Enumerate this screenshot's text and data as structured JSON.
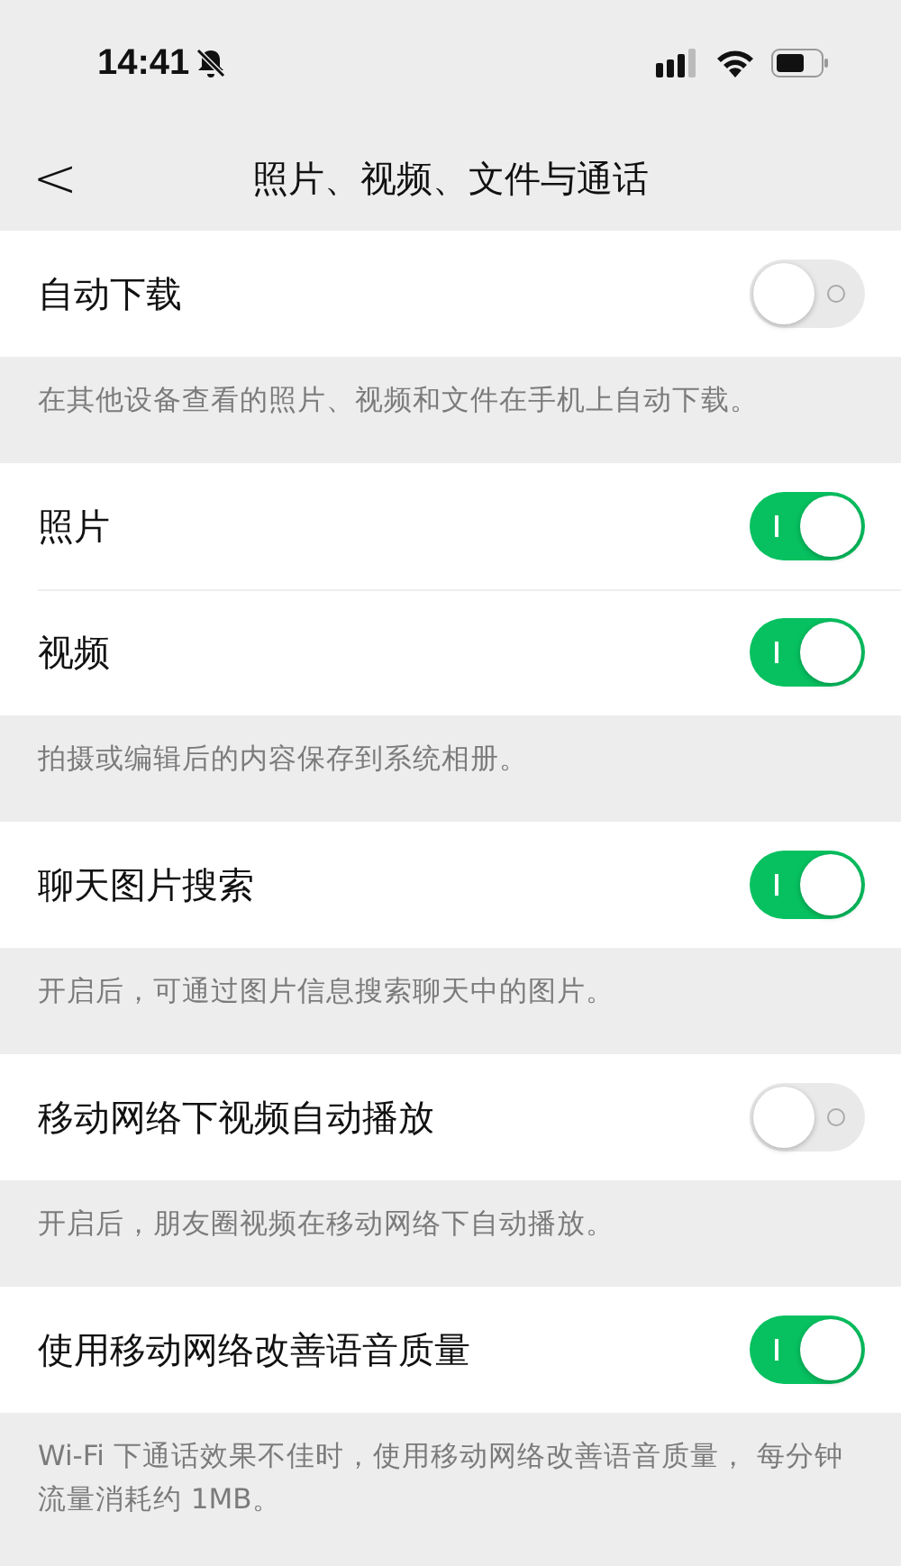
{
  "status_bar": {
    "time": "14:41"
  },
  "nav": {
    "back": "<",
    "title": "照片、视频、文件与通话"
  },
  "groups": [
    {
      "rows": [
        {
          "label": "自动下载",
          "on": false
        }
      ],
      "note": "在其他设备查看的照片、视频和文件在手机上自动下载。"
    },
    {
      "rows": [
        {
          "label": "照片",
          "on": true
        },
        {
          "label": "视频",
          "on": true
        }
      ],
      "note": "拍摄或编辑后的内容保存到系统相册。"
    },
    {
      "rows": [
        {
          "label": "聊天图片搜索",
          "on": true
        }
      ],
      "note": "开启后，可通过图片信息搜索聊天中的图片。"
    },
    {
      "rows": [
        {
          "label": "移动网络下视频自动播放",
          "on": false
        }
      ],
      "note": "开启后，朋友圈视频在移动网络下自动播放。"
    },
    {
      "rows": [
        {
          "label": "使用移动网络改善语音质量",
          "on": true
        }
      ],
      "note": "Wi-Fi 下通话效果不佳时，使用移动网络改善语音质量， 每分钟流量消耗约 1MB。"
    }
  ]
}
